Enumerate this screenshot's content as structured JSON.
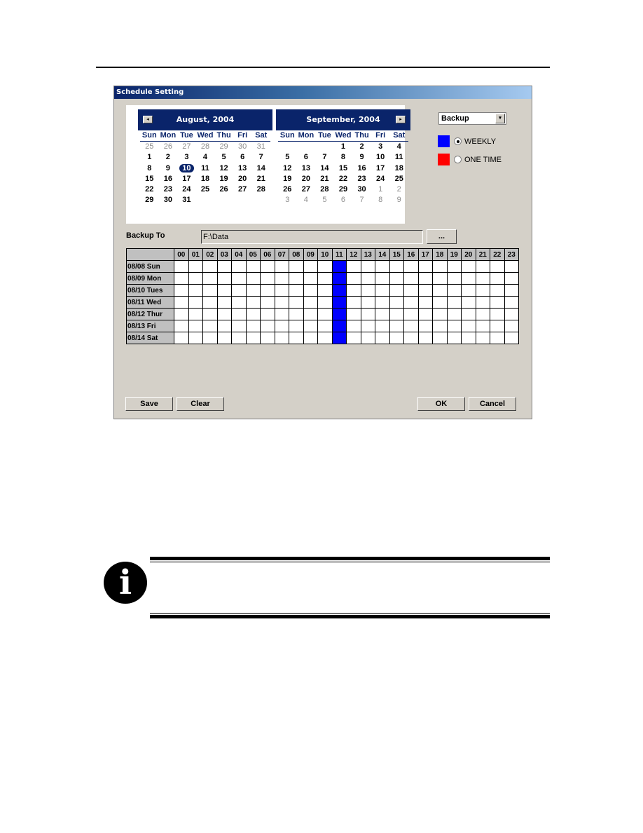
{
  "dialog": {
    "title": "Schedule Setting"
  },
  "calendar": {
    "weekdays": [
      "Sun",
      "Mon",
      "Tue",
      "Wed",
      "Thu",
      "Fri",
      "Sat"
    ],
    "months": [
      {
        "title": "August, 2004",
        "nav": "prev",
        "days": [
          {
            "d": "25",
            "other": true
          },
          {
            "d": "26",
            "other": true
          },
          {
            "d": "27",
            "other": true
          },
          {
            "d": "28",
            "other": true
          },
          {
            "d": "29",
            "other": true
          },
          {
            "d": "30",
            "other": true
          },
          {
            "d": "31",
            "other": true
          },
          {
            "d": "1"
          },
          {
            "d": "2"
          },
          {
            "d": "3"
          },
          {
            "d": "4"
          },
          {
            "d": "5"
          },
          {
            "d": "6"
          },
          {
            "d": "7"
          },
          {
            "d": "8"
          },
          {
            "d": "9"
          },
          {
            "d": "10",
            "selected": true
          },
          {
            "d": "11"
          },
          {
            "d": "12"
          },
          {
            "d": "13"
          },
          {
            "d": "14"
          },
          {
            "d": "15"
          },
          {
            "d": "16"
          },
          {
            "d": "17"
          },
          {
            "d": "18"
          },
          {
            "d": "19"
          },
          {
            "d": "20"
          },
          {
            "d": "21"
          },
          {
            "d": "22"
          },
          {
            "d": "23"
          },
          {
            "d": "24"
          },
          {
            "d": "25"
          },
          {
            "d": "26"
          },
          {
            "d": "27"
          },
          {
            "d": "28"
          },
          {
            "d": "29"
          },
          {
            "d": "30"
          },
          {
            "d": "31"
          },
          {
            "d": ""
          },
          {
            "d": ""
          },
          {
            "d": ""
          },
          {
            "d": ""
          }
        ]
      },
      {
        "title": "September, 2004",
        "nav": "next",
        "days": [
          {
            "d": ""
          },
          {
            "d": ""
          },
          {
            "d": ""
          },
          {
            "d": "1"
          },
          {
            "d": "2"
          },
          {
            "d": "3"
          },
          {
            "d": "4"
          },
          {
            "d": "5"
          },
          {
            "d": "6"
          },
          {
            "d": "7"
          },
          {
            "d": "8"
          },
          {
            "d": "9"
          },
          {
            "d": "10"
          },
          {
            "d": "11"
          },
          {
            "d": "12"
          },
          {
            "d": "13"
          },
          {
            "d": "14"
          },
          {
            "d": "15"
          },
          {
            "d": "16"
          },
          {
            "d": "17"
          },
          {
            "d": "18"
          },
          {
            "d": "19"
          },
          {
            "d": "20"
          },
          {
            "d": "21"
          },
          {
            "d": "22"
          },
          {
            "d": "23"
          },
          {
            "d": "24"
          },
          {
            "d": "25"
          },
          {
            "d": "26"
          },
          {
            "d": "27"
          },
          {
            "d": "28"
          },
          {
            "d": "29"
          },
          {
            "d": "30"
          },
          {
            "d": "1",
            "other": true
          },
          {
            "d": "2",
            "other": true
          },
          {
            "d": "3",
            "other": true
          },
          {
            "d": "4",
            "other": true
          },
          {
            "d": "5",
            "other": true
          },
          {
            "d": "6",
            "other": true
          },
          {
            "d": "7",
            "other": true
          },
          {
            "d": "8",
            "other": true
          },
          {
            "d": "9",
            "other": true
          }
        ]
      }
    ],
    "prev_icon": "◂",
    "next_icon": "▸"
  },
  "schedule_type": {
    "selected": "Backup",
    "dropdown_icon": "▾"
  },
  "legend": {
    "weekly": {
      "label": "WEEKLY",
      "color": "#0000ff",
      "checked": true
    },
    "one_time": {
      "label": "ONE TIME",
      "color": "#ff0000",
      "checked": false
    }
  },
  "backup": {
    "label": "Backup To",
    "path": "F:\\Data",
    "browse_label": "..."
  },
  "grid": {
    "hours": [
      "00",
      "01",
      "02",
      "03",
      "04",
      "05",
      "06",
      "07",
      "08",
      "09",
      "10",
      "11",
      "12",
      "13",
      "14",
      "15",
      "16",
      "17",
      "18",
      "19",
      "20",
      "21",
      "22",
      "23"
    ],
    "rows": [
      "08/08 Sun",
      "08/09 Mon",
      "08/10 Tues",
      "08/11 Wed",
      "08/12 Thur",
      "08/13 Fri",
      "08/14 Sat"
    ],
    "weekly_hours": [
      11
    ],
    "one_time_hours": []
  },
  "buttons": {
    "save": "Save",
    "clear": "Clear",
    "ok": "OK",
    "cancel": "Cancel"
  },
  "note": {
    "icon": "i"
  }
}
